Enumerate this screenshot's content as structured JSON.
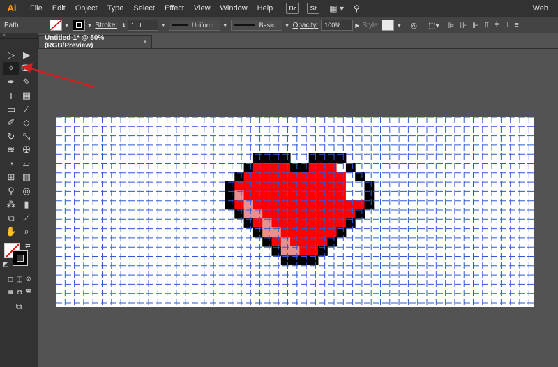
{
  "app": {
    "logo": "Ai"
  },
  "menu": [
    "File",
    "Edit",
    "Object",
    "Type",
    "Select",
    "Effect",
    "View",
    "Window",
    "Help"
  ],
  "menu_badges": [
    "Br",
    "St"
  ],
  "workspace": "Web",
  "control_bar": {
    "selection_label": "Path",
    "stroke_label": "Stroke:",
    "stroke_weight": "1 pt",
    "profile_label": "Uniform",
    "brush_label": "Basic",
    "opacity_label": "Opacity:",
    "opacity_value": "100%",
    "style_label": "Style:"
  },
  "document": {
    "tab_title": "Untitled-1* @ 50% (RGB/Preview)",
    "close_glyph": "×"
  },
  "tools": [
    {
      "name": "selection-tool-icon",
      "glyph": "▷"
    },
    {
      "name": "direct-selection-tool-icon",
      "glyph": "▶"
    },
    {
      "name": "magic-wand-tool-icon",
      "glyph": "✧"
    },
    {
      "name": "lasso-tool-icon",
      "glyph": "ↂ"
    },
    {
      "name": "pen-tool-icon",
      "glyph": "✒"
    },
    {
      "name": "curvature-tool-icon",
      "glyph": "✎"
    },
    {
      "name": "type-tool-icon",
      "glyph": "T"
    },
    {
      "name": "grid-tool-icon",
      "glyph": "▦"
    },
    {
      "name": "rectangle-tool-icon",
      "glyph": "▭"
    },
    {
      "name": "paintbrush-tool-icon",
      "glyph": "∕"
    },
    {
      "name": "shaper-tool-icon",
      "glyph": "✐"
    },
    {
      "name": "eraser-tool-icon",
      "glyph": "◇"
    },
    {
      "name": "rotate-tool-icon",
      "glyph": "↻"
    },
    {
      "name": "scale-tool-icon",
      "glyph": "⤡"
    },
    {
      "name": "warp-tool-icon",
      "glyph": "≋"
    },
    {
      "name": "puppet-warp-tool-icon",
      "glyph": "✠"
    },
    {
      "name": "shape-builder-tool-icon",
      "glyph": "◔"
    },
    {
      "name": "perspective-grid-tool-icon",
      "glyph": "▱"
    },
    {
      "name": "mesh-tool-icon",
      "glyph": "⊞"
    },
    {
      "name": "gradient-tool-icon",
      "glyph": "▥"
    },
    {
      "name": "eyedropper-tool-icon",
      "glyph": "⚲"
    },
    {
      "name": "blend-tool-icon",
      "glyph": "◎"
    },
    {
      "name": "symbol-sprayer-tool-icon",
      "glyph": "⁂"
    },
    {
      "name": "column-graph-tool-icon",
      "glyph": "▮"
    },
    {
      "name": "artboard-tool-icon",
      "glyph": "⧉"
    },
    {
      "name": "slice-tool-icon",
      "glyph": "⟋"
    },
    {
      "name": "hand-tool-icon",
      "glyph": "✋"
    },
    {
      "name": "zoom-tool-icon",
      "glyph": "⌕"
    }
  ],
  "colors": {
    "heart_red": "#ff0000",
    "heart_outline": "#000000",
    "heart_highlight": "#ffffff",
    "heart_shade": "#e89090",
    "grid_line": "#2f5bd6",
    "annotation_arrow": "#d42020"
  },
  "heart_pixels": [
    "...XXXX..XXXX...",
    "..XRRRRXXRRRWX..",
    ".XRRRRRRRRRRRWX.",
    "XRRRRRRRRRRRRWWX",
    "XPRRRRRRRRRRRWWX",
    "XRPRRRRRRRRRRRRX",
    ".XPPRRRRRRRRRRX.",
    "..XRPRRRRRRRRX..",
    "...XPPRRRRRRX...",
    "....XRPRRRRX....",
    ".....XPPRRX.....",
    "......XXXX......"
  ]
}
